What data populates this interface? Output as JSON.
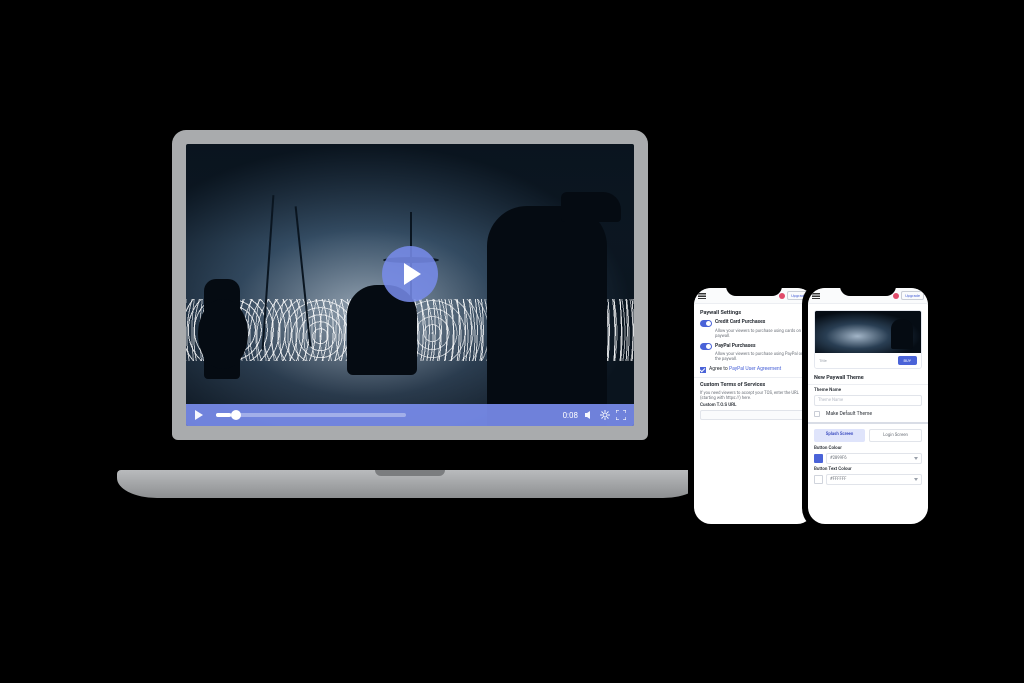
{
  "player": {
    "timestamp": "0:08"
  },
  "topbar": {
    "upgrade": "Upgrade"
  },
  "phone_a": {
    "title": "Paywall Settings",
    "cc_label": "Credit Card Purchases",
    "cc_desc": "Allow your viewers to purchase using cards on the paywall.",
    "pp_label": "PayPal Purchases",
    "pp_desc": "Allow your viewers to purchase using PayPal on the paywall.",
    "agree_prefix": "Agree to ",
    "agree_link": "PayPal User Agreement",
    "tos_title": "Custom Terms of Services",
    "tos_desc": "If you need viewers to accept your TOS, enter the URL (starting with https://) here.",
    "tos_url_label": "Custom T.O.S URL",
    "tos_url_value": ""
  },
  "phone_b": {
    "preview_label": "Title",
    "preview_btn": "BUY",
    "section_title": "New Paywall Theme",
    "name_label": "Theme Name",
    "name_placeholder": "Theme Name",
    "default_label": "Make Default Theme",
    "tab_splash": "Splash Screen",
    "tab_login": "Login Screen",
    "btn_color_label": "Button Colour",
    "btn_color_value": "#2899F6",
    "btn_text_color_label": "Button Text Colour",
    "btn_text_color_value": "#FFFFFF"
  }
}
